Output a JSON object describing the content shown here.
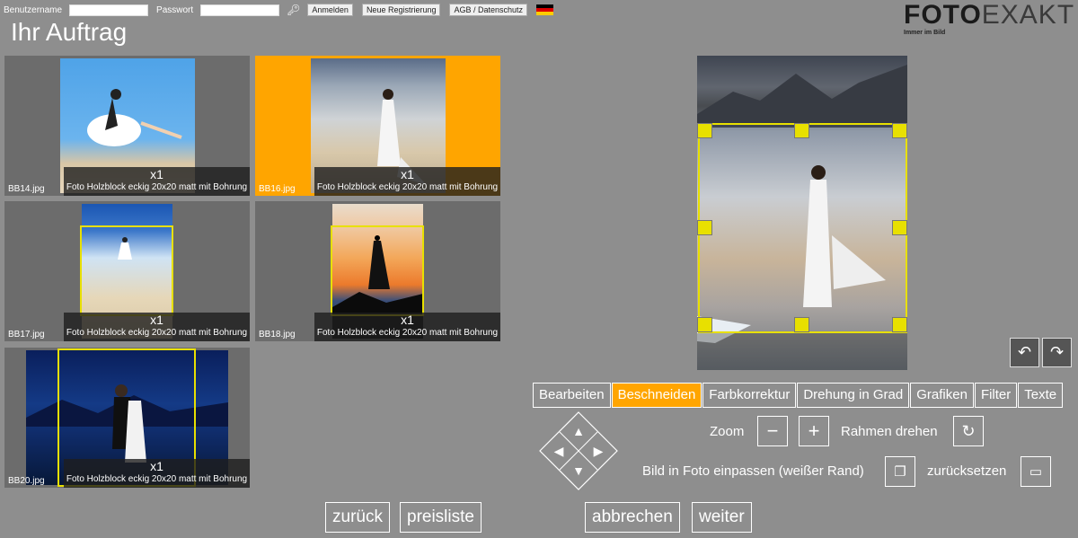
{
  "login": {
    "username_label": "Benutzername",
    "password_label": "Passwort",
    "login_button": "Anmelden",
    "register_button": "Neue Registrierung",
    "terms_button": "AGB / Datenschutz",
    "language_icon": "german-flag-icon"
  },
  "logo": {
    "word1": "FOTO",
    "word2": "EXAKT",
    "tagline": "Immer im Bild"
  },
  "page_title": "Ihr Auftrag",
  "items": [
    {
      "file": "BB14.jpg",
      "qty": "x1",
      "product": "Foto Holzblock eckig 20x20 matt mit Bohrung"
    },
    {
      "file": "BB16.jpg",
      "qty": "x1",
      "product": "Foto Holzblock eckig 20x20 matt mit Bohrung",
      "selected": true
    },
    {
      "file": "BB17.jpg",
      "qty": "x1",
      "product": "Foto Holzblock eckig 20x20 matt mit Bohrung"
    },
    {
      "file": "BB18.jpg",
      "qty": "x1",
      "product": "Foto Holzblock eckig 20x20 matt mit Bohrung"
    },
    {
      "file": "BB20.jpg",
      "qty": "x1",
      "product": "Foto Holzblock eckig 20x20 matt mit Bohrung"
    }
  ],
  "tabs": [
    "Bearbeiten",
    "Beschneiden",
    "Farbkorrektur",
    "Drehung in Grad",
    "Grafiken",
    "Filter",
    "Texte"
  ],
  "active_tab": "Beschneiden",
  "controls": {
    "zoom_label": "Zoom",
    "zoom_out": "−",
    "zoom_in": "+",
    "rotate_frame_label": "Rahmen drehen",
    "fit_label": "Bild in Foto einpassen (weißer Rand)",
    "reset_label": "zurücksetzen"
  },
  "nav": {
    "back": "zurück",
    "pricelist": "preisliste",
    "cancel": "abbrechen",
    "next": "weiter"
  },
  "colors": {
    "background": "#8e8e8e",
    "accent": "#ffa500",
    "crop": "#e8e000"
  }
}
